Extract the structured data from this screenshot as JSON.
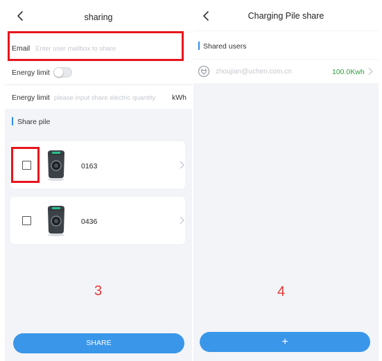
{
  "left_screen": {
    "title": "sharing",
    "email": {
      "label": "Email",
      "placeholder": "Enter user mailbox to share"
    },
    "energy_toggle": {
      "label": "Energy limit",
      "on": false
    },
    "energy_input": {
      "label": "Energy limit",
      "placeholder": "please input share electric quantity",
      "unit": "kWh"
    },
    "section_title": "Share pile",
    "piles": [
      {
        "name": "0163",
        "checked": false
      },
      {
        "name": "0436",
        "checked": false
      }
    ],
    "step_number": "3",
    "share_button": "SHARE"
  },
  "right_screen": {
    "title": "Charging Pile share",
    "section_title": "Shared users",
    "users": [
      {
        "email": "zhoujian@uchen.com.cn",
        "amount": "100.0Kwh"
      }
    ],
    "step_number": "4",
    "add_button": "+"
  },
  "colors": {
    "accent": "#3a96e8",
    "highlight": "#e8141b",
    "amount": "#2e9e3a",
    "step": "#e53935"
  }
}
